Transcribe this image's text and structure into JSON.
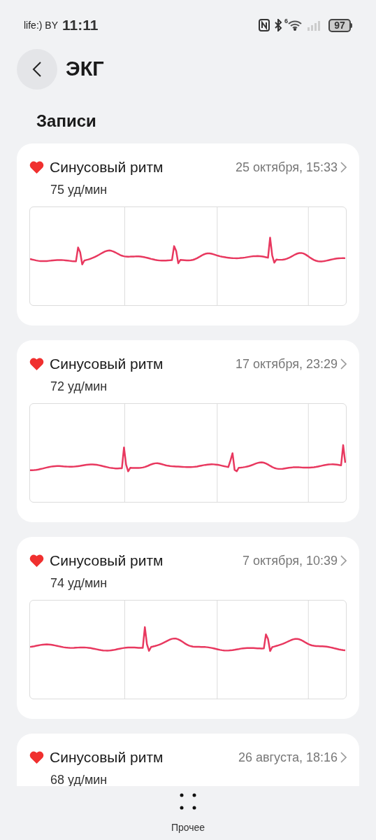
{
  "status_bar": {
    "carrier": "life:) BY",
    "time": "11:11",
    "network_label": "6",
    "battery": "97"
  },
  "header": {
    "title": "ЭКГ"
  },
  "section_title": "Записи",
  "records": [
    {
      "rhythm": "Синусовый ритм",
      "datetime": "25 октября, 15:33",
      "heart_rate": "75 уд/мин"
    },
    {
      "rhythm": "Синусовый ритм",
      "datetime": "17 октября, 23:29",
      "heart_rate": "72 уд/мин"
    },
    {
      "rhythm": "Синусовый ритм",
      "datetime": "7 октября, 10:39",
      "heart_rate": "74 уд/мин"
    },
    {
      "rhythm": "Синусовый ритм",
      "datetime": "26 августа, 18:16",
      "heart_rate": "68 уд/мин"
    }
  ],
  "bottom_bar": {
    "label": "Прочее"
  }
}
